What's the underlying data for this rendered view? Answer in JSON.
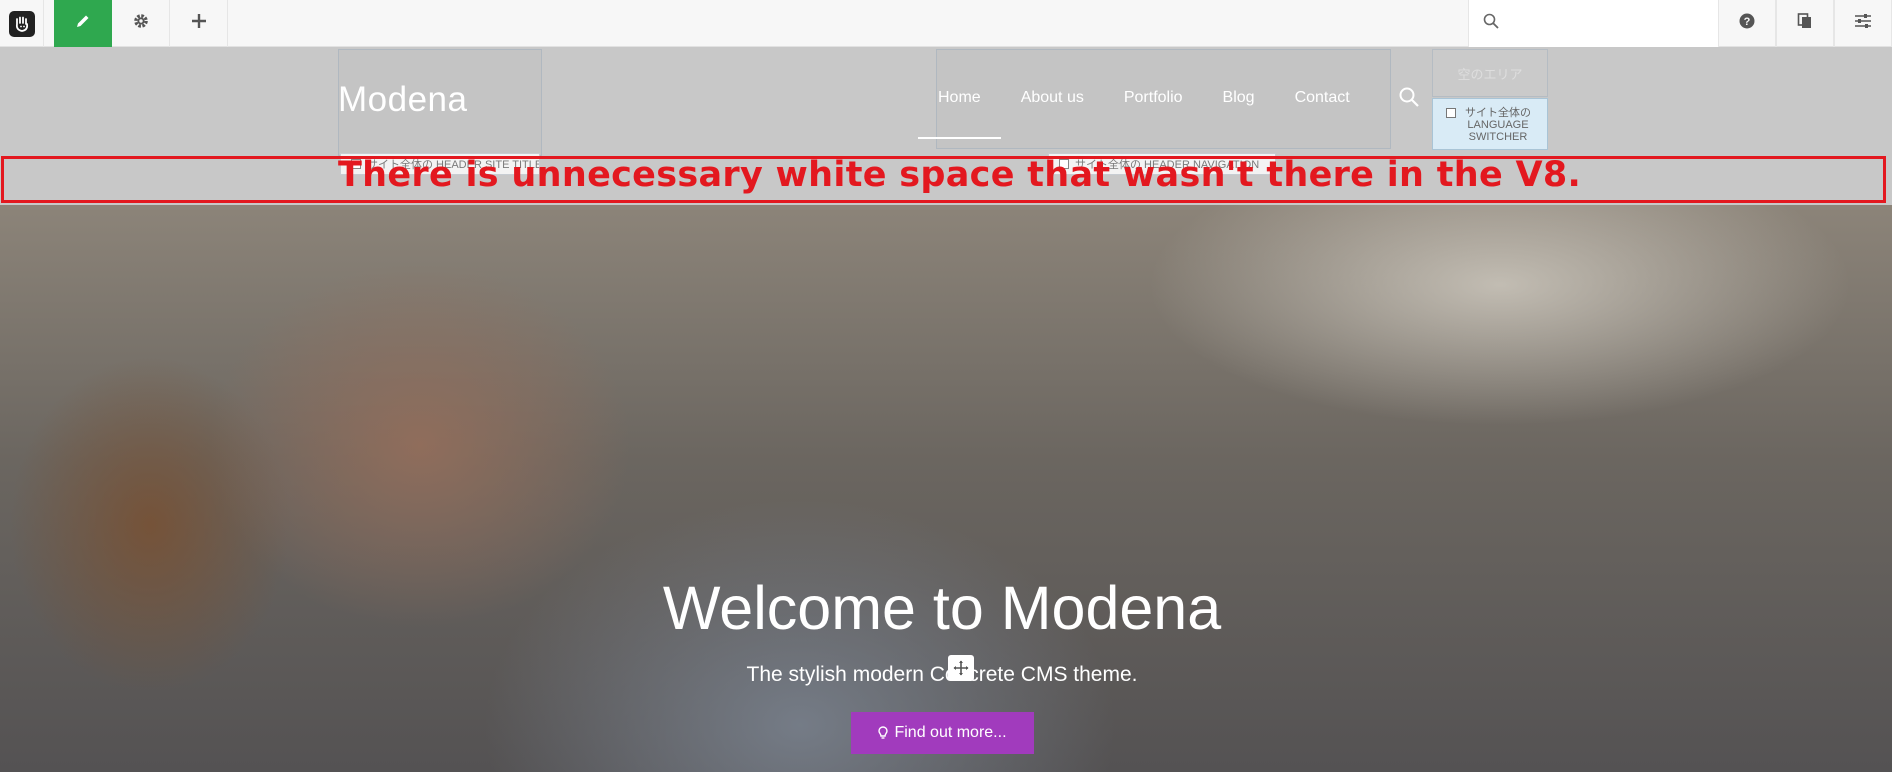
{
  "toolbar": {
    "search_placeholder": "",
    "icons": {
      "logo": "concrete-hand-icon",
      "edit": "pencil-icon",
      "settings": "gear-icon",
      "add": "plus-icon",
      "search": "search-icon",
      "help": "help-icon",
      "pages": "sitemap-icon",
      "panel": "sliders-icon"
    },
    "edit_color": "#2fa84f"
  },
  "header": {
    "site_name": "Modena",
    "site_name_area_tag": "サイト全体の HEADER SITE TITLE",
    "nav_area_tag": "サイト全体の HEADER NAVIGATION",
    "nav": [
      {
        "label": "Home",
        "active": true
      },
      {
        "label": "About us"
      },
      {
        "label": "Portfolio"
      },
      {
        "label": "Blog"
      },
      {
        "label": "Contact"
      }
    ],
    "empty_area": "空のエリア",
    "language_switcher_label": "サイト全体の LANGUAGE SWITCHER"
  },
  "annotation": {
    "text": "There is unnecessary white space that wasn't there in the V8.",
    "color": "#e3181f"
  },
  "hero": {
    "title": "Welcome to Modena",
    "subtitle": "The stylish modern Concrete CMS theme.",
    "button_label": "Find out more...",
    "button_icon": "lightbulb-icon",
    "button_color": "#a13bbd"
  }
}
